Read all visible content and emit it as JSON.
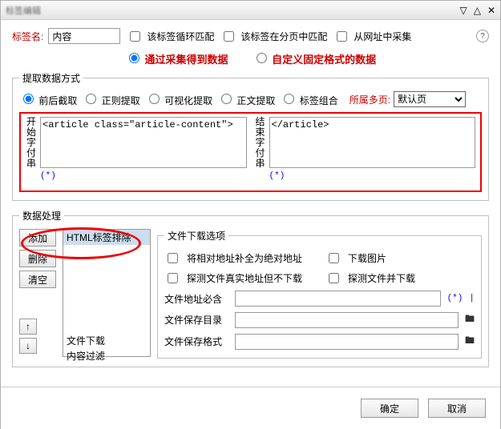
{
  "titlebar": {
    "title": "标签编辑"
  },
  "top": {
    "name_label": "标签名:",
    "name_value": "内容",
    "opt_loop": "该标签循环匹配",
    "opt_page": "该标签在分页中匹配",
    "opt_url": "从网址中采集",
    "help": "?"
  },
  "mode": {
    "collect": "通过采集得到数据",
    "fixed": "自定义固定格式的数据"
  },
  "extract": {
    "legend": "提取数据方式",
    "r1": "前后截取",
    "r2": "正则提取",
    "r3": "可视化提取",
    "r4": "正文提取",
    "r5": "标签组合",
    "page_label": "所属多页:",
    "page_value": "默认页",
    "start_label": "开始字付串",
    "end_label": "结束字付串",
    "start_value": "<article class=\"article-content\">",
    "end_value": "</article>",
    "star": "(*)"
  },
  "process": {
    "legend": "数据处理",
    "add": "添加",
    "del": "删除",
    "clear": "清空",
    "up": "↑",
    "down": "↓",
    "list": [
      "HTML标签排除",
      "文件下载",
      "内容过滤"
    ],
    "dl": {
      "legend": "文件下载选项",
      "opt_abs": "将相对地址补全为绝对地址",
      "opt_img": "下载图片",
      "opt_detect_nodl": "探测文件真实地址但不下载",
      "opt_detect_dl": "探测文件并下载",
      "must_label": "文件地址必含",
      "must_value": "",
      "dir_label": "文件保存目录",
      "dir_value": "",
      "fmt_label": "文件保存格式",
      "fmt_value": "",
      "star": "(*)",
      "bar": "|"
    }
  },
  "footer": {
    "ok": "确定",
    "cancel": "取消"
  }
}
